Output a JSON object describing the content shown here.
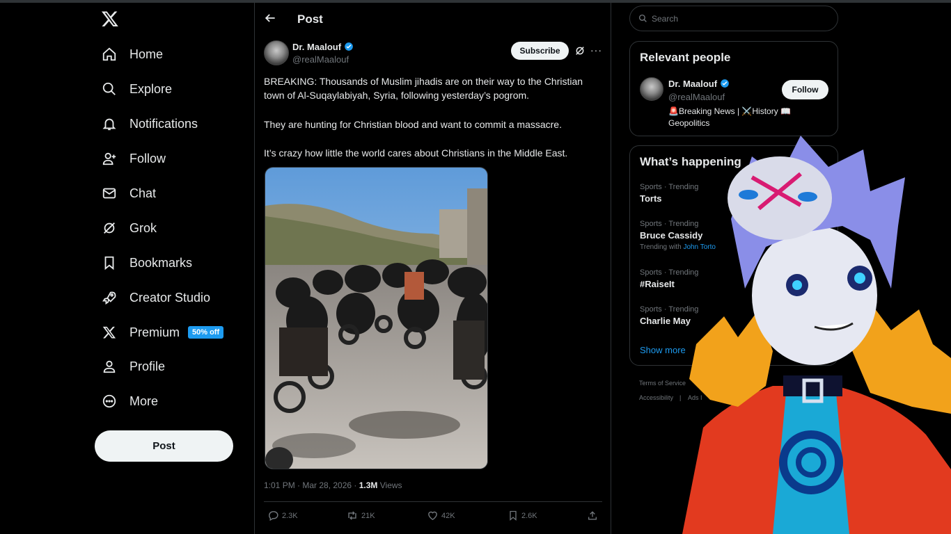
{
  "nav": {
    "items": [
      {
        "label": "Home",
        "icon": "home-icon"
      },
      {
        "label": "Explore",
        "icon": "search-icon"
      },
      {
        "label": "Notifications",
        "icon": "bell-icon"
      },
      {
        "label": "Follow",
        "icon": "person-plus-icon"
      },
      {
        "label": "Chat",
        "icon": "envelope-icon"
      },
      {
        "label": "Grok",
        "icon": "grok-icon"
      },
      {
        "label": "Bookmarks",
        "icon": "bookmark-icon"
      },
      {
        "label": "Creator Studio",
        "icon": "rocket-icon"
      },
      {
        "label": "Premium",
        "icon": "x-logo-icon",
        "badge": "50% off"
      },
      {
        "label": "Profile",
        "icon": "person-icon"
      },
      {
        "label": "More",
        "icon": "more-circle-icon"
      }
    ],
    "post_button": "Post"
  },
  "header": {
    "title": "Post"
  },
  "tweet": {
    "author_name": "Dr. Maalouf",
    "author_handle": "@realMaalouf",
    "subscribe_label": "Subscribe",
    "paragraphs": [
      "BREAKING: Thousands of Muslim jihadis are on their way to the Christian town of Al-Suqaylabiyah, Syria, following yesterday’s pogrom.",
      "They are hunting for Christian blood and want to commit a massacre.",
      "It’s crazy how little the world cares about Christians in the Middle East."
    ],
    "time": "1:01 PM · Mar 28, 2026 · ",
    "views_count": "1.3M",
    "views_label": " Views",
    "actions": {
      "replies": "2.3K",
      "reposts": "21K",
      "likes": "42K",
      "bookmarks": "2.6K"
    }
  },
  "search": {
    "placeholder": "Search"
  },
  "relevant_people": {
    "title": "Relevant people",
    "name": "Dr. Maalouf",
    "handle": "@realMaalouf",
    "bio": "🚨Breaking News | ⚔️History 📖 Geopolitics",
    "follow_label": "Follow"
  },
  "happening": {
    "title": "What’s happening",
    "trends": [
      {
        "category": "Sports · Trending",
        "name": "Torts"
      },
      {
        "category": "Sports · Trending",
        "name": "Bruce Cassidy",
        "with_prefix": "Trending with ",
        "with_link": "John Torto"
      },
      {
        "category": "Sports · Trending",
        "name": "#RaiseIt"
      },
      {
        "category": "Sports · Trending",
        "name": "Charlie May"
      }
    ],
    "show_more": "Show more"
  },
  "footer": {
    "terms": "Terms of Service",
    "accessibility": "Accessibility",
    "sep": "|",
    "ads": "Ads I"
  },
  "colors": {
    "accent": "#1d9bf0",
    "background": "#000000",
    "border": "#2f3336"
  }
}
